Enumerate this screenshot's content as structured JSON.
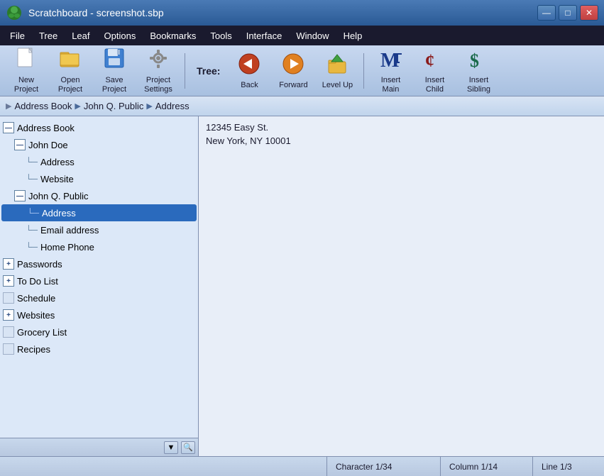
{
  "titleBar": {
    "title": "Scratchboard - screenshot.sbp",
    "minBtn": "—",
    "maxBtn": "□",
    "closeBtn": "✕"
  },
  "menuBar": {
    "items": [
      {
        "label": "File",
        "underline": "F"
      },
      {
        "label": "Tree",
        "underline": "T"
      },
      {
        "label": "Leaf",
        "underline": "L"
      },
      {
        "label": "Options",
        "underline": "O"
      },
      {
        "label": "Bookmarks",
        "underline": "B"
      },
      {
        "label": "Tools",
        "underline": "T"
      },
      {
        "label": "Interface",
        "underline": "I"
      },
      {
        "label": "Window",
        "underline": "W"
      },
      {
        "label": "Help",
        "underline": "H"
      }
    ]
  },
  "toolbar": {
    "treeLabel": "Tree:",
    "buttons": [
      {
        "name": "new-project",
        "icon": "📄",
        "label": "New\nProject"
      },
      {
        "name": "open-project",
        "icon": "📂",
        "label": "Open\nProject"
      },
      {
        "name": "save-project",
        "icon": "💾",
        "label": "Save\nProject"
      },
      {
        "name": "project-settings",
        "icon": "⚙",
        "label": "Project\nSettings"
      },
      {
        "name": "back",
        "icon": "⬅",
        "label": "Back",
        "color": "#c04020"
      },
      {
        "name": "forward",
        "icon": "➡",
        "label": "Forward",
        "color": "#e08020"
      },
      {
        "name": "level-up",
        "icon": "📁",
        "label": "Level Up",
        "color": "#d4a020"
      },
      {
        "name": "insert-main",
        "icon": "Ӎ",
        "label": "Insert\nMain",
        "color": "#1a3a8a"
      },
      {
        "name": "insert-child",
        "icon": "₵",
        "label": "Insert\nChild",
        "color": "#8a1a1a"
      },
      {
        "name": "insert-sibling",
        "icon": "$",
        "label": "Insert\nSibling",
        "color": "#1a6a4a"
      }
    ]
  },
  "breadcrumb": {
    "items": [
      "Address Book",
      "John Q. Public",
      "Address"
    ]
  },
  "tree": {
    "nodes": [
      {
        "id": "address-book",
        "label": "Address Book",
        "level": 0,
        "expandIcon": "—",
        "type": "root-expanded"
      },
      {
        "id": "john-doe",
        "label": "John Doe",
        "level": 1,
        "expandIcon": "—",
        "type": "expanded"
      },
      {
        "id": "address-jd",
        "label": "Address",
        "level": 2,
        "type": "leaf"
      },
      {
        "id": "website-jd",
        "label": "Website",
        "level": 2,
        "type": "leaf"
      },
      {
        "id": "john-q-public",
        "label": "John Q. Public",
        "level": 1,
        "expandIcon": "—",
        "type": "expanded"
      },
      {
        "id": "address-jqp",
        "label": "Address",
        "level": 2,
        "type": "leaf",
        "selected": true
      },
      {
        "id": "email-jqp",
        "label": "Email address",
        "level": 2,
        "type": "leaf"
      },
      {
        "id": "phone-jqp",
        "label": "Home Phone",
        "level": 2,
        "type": "leaf"
      },
      {
        "id": "passwords",
        "label": "Passwords",
        "level": 0,
        "expandIcon": "+",
        "type": "collapsed"
      },
      {
        "id": "todo",
        "label": "To Do List",
        "level": 0,
        "expandIcon": "+",
        "type": "collapsed"
      },
      {
        "id": "schedule",
        "label": "Schedule",
        "level": 0,
        "expandIcon": "□",
        "type": "nochildren"
      },
      {
        "id": "websites",
        "label": "Websites",
        "level": 0,
        "expandIcon": "+",
        "type": "collapsed"
      },
      {
        "id": "grocery",
        "label": "Grocery List",
        "level": 0,
        "expandIcon": "□",
        "type": "nochildren"
      },
      {
        "id": "recipes",
        "label": "Recipes",
        "level": 0,
        "expandIcon": "□",
        "type": "nochildren"
      }
    ]
  },
  "content": {
    "lines": [
      "12345 Easy St.",
      "New York, NY 10001"
    ]
  },
  "statusBar": {
    "empty": "",
    "character": "Character 1/34",
    "column": "Column 1/14",
    "line": "Line 1/3"
  }
}
